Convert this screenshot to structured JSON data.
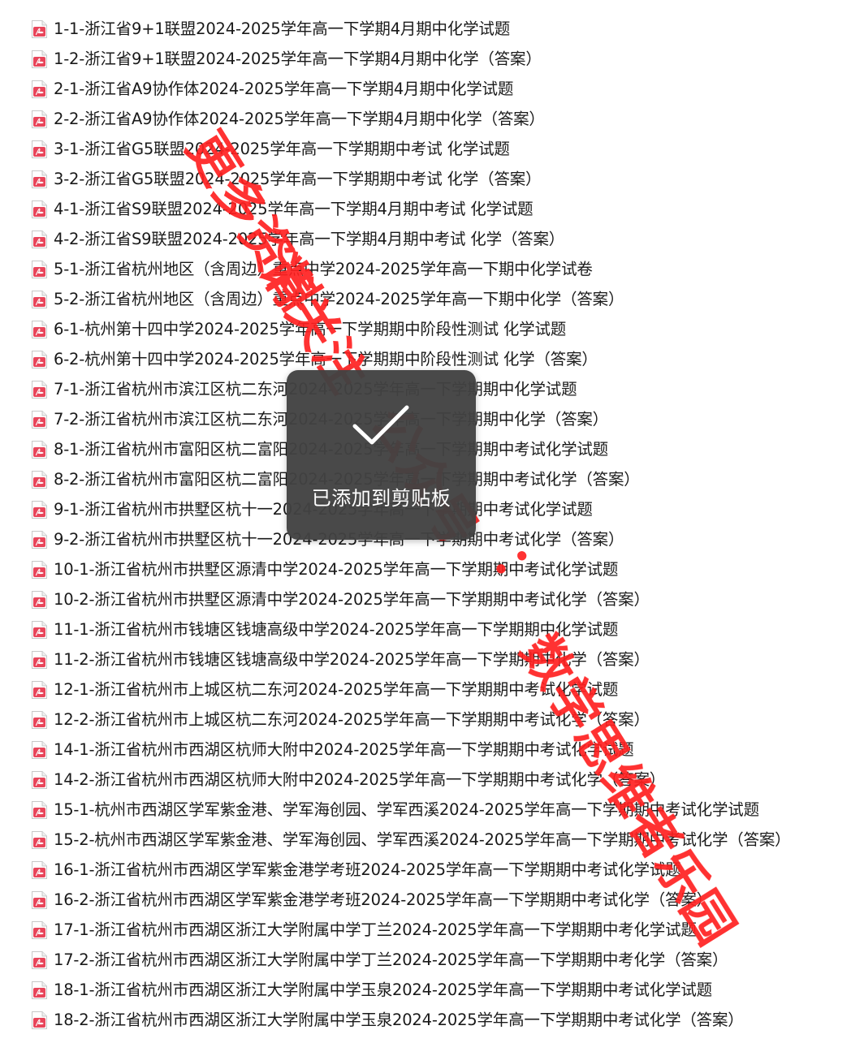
{
  "files": [
    {
      "name": "1-1-浙江省9+1联盟2024-2025学年高一下学期4月期中化学试题",
      "icon": "pdf-file-icon"
    },
    {
      "name": "1-2-浙江省9+1联盟2024-2025学年高一下学期4月期中化学（答案）",
      "icon": "pdf-file-icon"
    },
    {
      "name": "2-1-浙江省A9协作体2024-2025学年高一下学期4月期中化学试题",
      "icon": "pdf-file-icon"
    },
    {
      "name": "2-2-浙江省A9协作体2024-2025学年高一下学期4月期中化学（答案）",
      "icon": "pdf-file-icon"
    },
    {
      "name": "3-1-浙江省G5联盟2024-2025学年高一下学期期中考试 化学试题",
      "icon": "pdf-file-icon"
    },
    {
      "name": "3-2-浙江省G5联盟2024-2025学年高一下学期期中考试 化学（答案）",
      "icon": "pdf-file-icon"
    },
    {
      "name": "4-1-浙江省S9联盟2024-2025学年高一下学期4月期中考试 化学试题",
      "icon": "pdf-file-icon"
    },
    {
      "name": "4-2-浙江省S9联盟2024-2025学年高一下学期4月期中考试 化学（答案）",
      "icon": "pdf-file-icon"
    },
    {
      "name": "5-1-浙江省杭州地区（含周边）重点中学2024-2025学年高一下期中化学试卷",
      "icon": "pdf-file-icon"
    },
    {
      "name": "5-2-浙江省杭州地区（含周边）重点中学2024-2025学年高一下期中化学（答案）",
      "icon": "pdf-file-icon"
    },
    {
      "name": "6-1-杭州第十四中学2024-2025学年高一下学期期中阶段性测试 化学试题",
      "icon": "pdf-file-icon"
    },
    {
      "name": "6-2-杭州第十四中学2024-2025学年高一下学期期中阶段性测试 化学（答案）",
      "icon": "pdf-file-icon"
    },
    {
      "name": "7-1-浙江省杭州市滨江区杭二东河2024-2025学年高一下学期期中化学试题",
      "icon": "pdf-file-icon"
    },
    {
      "name": "7-2-浙江省杭州市滨江区杭二东河2024-2025学年高一下学期期中化学（答案）",
      "icon": "pdf-file-icon"
    },
    {
      "name": "8-1-浙江省杭州市富阳区杭二富阳2024-2025学年高一下学期期中考试化学试题",
      "icon": "pdf-file-icon"
    },
    {
      "name": "8-2-浙江省杭州市富阳区杭二富阳2024-2025学年高一下学期期中考试化学（答案）",
      "icon": "pdf-file-icon"
    },
    {
      "name": "9-1-浙江省杭州市拱墅区杭十一2024-2025学年高一下学期期中考试化学试题",
      "icon": "pdf-file-icon"
    },
    {
      "name": "9-2-浙江省杭州市拱墅区杭十一2024-2025学年高一下学期期中考试化学（答案）",
      "icon": "pdf-file-icon"
    },
    {
      "name": "10-1-浙江省杭州市拱墅区源清中学2024-2025学年高一下学期期中考试化学试题",
      "icon": "pdf-file-icon"
    },
    {
      "name": "10-2-浙江省杭州市拱墅区源清中学2024-2025学年高一下学期期中考试化学（答案）",
      "icon": "pdf-file-icon"
    },
    {
      "name": "11-1-浙江省杭州市钱塘区钱塘高级中学2024-2025学年高一下学期期中化学试题",
      "icon": "pdf-file-icon"
    },
    {
      "name": "11-2-浙江省杭州市钱塘区钱塘高级中学2024-2025学年高一下学期期中化学（答案）",
      "icon": "pdf-file-icon"
    },
    {
      "name": "12-1-浙江省杭州市上城区杭二东河2024-2025学年高一下学期期中考试化学试题",
      "icon": "pdf-file-icon"
    },
    {
      "name": "12-2-浙江省杭州市上城区杭二东河2024-2025学年高一下学期期中考试化学（答案）",
      "icon": "pdf-file-icon"
    },
    {
      "name": "14-1-浙江省杭州市西湖区杭师大附中2024-2025学年高一下学期期中考试化学试题",
      "icon": "pdf-file-icon"
    },
    {
      "name": "14-2-浙江省杭州市西湖区杭师大附中2024-2025学年高一下学期期中考试化学（答案）",
      "icon": "pdf-file-icon"
    },
    {
      "name": "15-1-杭州市西湖区学军紫金港、学军海创园、学军西溪2024-2025学年高一下学期期中考试化学试题",
      "icon": "pdf-file-icon"
    },
    {
      "name": "15-2-杭州市西湖区学军紫金港、学军海创园、学军西溪2024-2025学年高一下学期期中考试化学（答案）",
      "icon": "pdf-file-icon"
    },
    {
      "name": "16-1-浙江省杭州市西湖区学军紫金港学考班2024-2025学年高一下学期期中考试化学试题",
      "icon": "pdf-file-icon"
    },
    {
      "name": "16-2-浙江省杭州市西湖区学军紫金港学考班2024-2025学年高一下学期期中考试化学（答案）",
      "icon": "pdf-file-icon"
    },
    {
      "name": "17-1-浙江省杭州市西湖区浙江大学附属中学丁兰2024-2025学年高一下学期期中考化学试题",
      "icon": "pdf-file-icon"
    },
    {
      "name": "17-2-浙江省杭州市西湖区浙江大学附属中学丁兰2024-2025学年高一下学期期中考化学（答案）",
      "icon": "pdf-file-icon"
    },
    {
      "name": "18-1-浙江省杭州市西湖区浙江大学附属中学玉泉2024-2025学年高一下学期期中考试化学试题",
      "icon": "pdf-file-icon"
    },
    {
      "name": "18-2-浙江省杭州市西湖区浙江大学附属中学玉泉2024-2025学年高一下学期期中考试化学（答案）",
      "icon": "pdf-file-icon"
    }
  ],
  "toast": {
    "message": "已添加到剪贴板",
    "icon": "checkmark-icon"
  },
  "watermark": {
    "text": "更多资料请关注公众号：数学思维者乐园",
    "color": "#ff1a1a"
  },
  "colors": {
    "pdf_icon_red": "#e8455a",
    "toast_bg": "#424242"
  }
}
